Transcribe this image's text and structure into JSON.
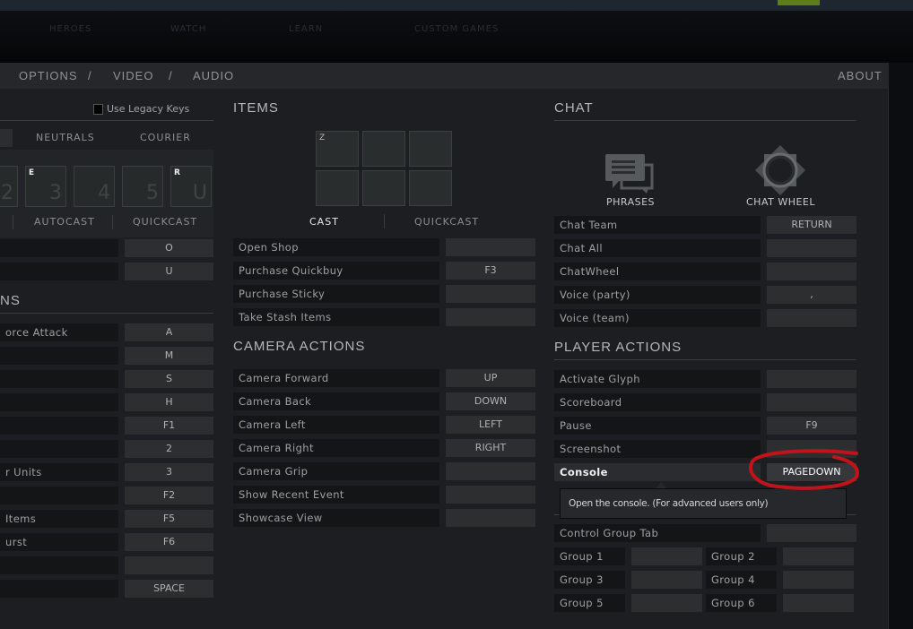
{
  "top_nav": [
    "HEROES",
    "WATCH",
    "LEARN",
    "CUSTOM GAMES"
  ],
  "header": {
    "nav": [
      "OPTIONS",
      "/",
      "VIDEO",
      "/",
      "AUDIO"
    ],
    "about": "ABOUT"
  },
  "left": {
    "legacy_keys": "Use Legacy Keys",
    "tabs": [
      "NEUTRALS",
      "COURIER"
    ],
    "abilities": [
      {
        "hotkey": "",
        "num": "2"
      },
      {
        "hotkey": "E",
        "num": "3"
      },
      {
        "hotkey": "",
        "num": "4"
      },
      {
        "hotkey": "",
        "num": "5"
      },
      {
        "hotkey": "R",
        "num": "U"
      }
    ],
    "cast_tabs": [
      "AUTOCAST",
      "QUICKCAST"
    ],
    "top_rows": [
      {
        "label": "",
        "key": "O"
      },
      {
        "label": "",
        "key": "U"
      }
    ],
    "section": "NS",
    "rows": [
      {
        "label": "orce Attack",
        "key": "A"
      },
      {
        "label": "",
        "key": "M"
      },
      {
        "label": "",
        "key": "S"
      },
      {
        "label": "",
        "key": "H"
      },
      {
        "label": "",
        "key": "F1"
      },
      {
        "label": "",
        "key": "2"
      },
      {
        "label": "r Units",
        "key": "3"
      },
      {
        "label": "",
        "key": "F2"
      },
      {
        "label": "Items",
        "key": "F5"
      },
      {
        "label": "urst",
        "key": "F6"
      },
      {
        "label": "",
        "key": ""
      },
      {
        "label": "",
        "key": "SPACE"
      }
    ]
  },
  "items": {
    "title": "ITEMS",
    "slot_hotkeys": [
      "Z",
      "",
      "",
      "",
      "",
      ""
    ],
    "tabs": [
      "CAST",
      "QUICKCAST"
    ],
    "rows": [
      {
        "label": "Open Shop",
        "key": ""
      },
      {
        "label": "Purchase Quickbuy",
        "key": "F3"
      },
      {
        "label": "Purchase Sticky",
        "key": ""
      },
      {
        "label": "Take Stash Items",
        "key": ""
      }
    ]
  },
  "camera": {
    "title": "CAMERA ACTIONS",
    "rows": [
      {
        "label": "Camera Forward",
        "key": "UP"
      },
      {
        "label": "Camera Back",
        "key": "DOWN"
      },
      {
        "label": "Camera Left",
        "key": "LEFT"
      },
      {
        "label": "Camera Right",
        "key": "RIGHT"
      },
      {
        "label": "Camera Grip",
        "key": ""
      },
      {
        "label": "Show Recent Event",
        "key": ""
      },
      {
        "label": "Showcase View",
        "key": ""
      }
    ]
  },
  "chat": {
    "title": "CHAT",
    "phrases": "PHRASES",
    "chat_wheel": "CHAT WHEEL",
    "rows": [
      {
        "label": "Chat Team",
        "key": "RETURN"
      },
      {
        "label": "Chat All",
        "key": ""
      },
      {
        "label": "ChatWheel",
        "key": ""
      },
      {
        "label": "Voice (party)",
        "key": ","
      },
      {
        "label": "Voice (team)",
        "key": ""
      }
    ]
  },
  "player": {
    "title": "PLAYER ACTIONS",
    "rows": [
      {
        "label": "Activate Glyph",
        "key": ""
      },
      {
        "label": "Scoreboard",
        "key": ""
      },
      {
        "label": "Pause",
        "key": "F9"
      },
      {
        "label": "Screenshot",
        "key": ""
      },
      {
        "label": "Console",
        "key": "PAGEDOWN"
      }
    ]
  },
  "tooltip": "Open the console. (For advanced users only)",
  "control": {
    "tab_row": {
      "label": "Control Group Tab",
      "key": ""
    },
    "groups": [
      {
        "label": "Group 1",
        "key": ""
      },
      {
        "label": "Group 2",
        "key": ""
      },
      {
        "label": "Group 3",
        "key": ""
      },
      {
        "label": "Group 4",
        "key": ""
      },
      {
        "label": "Group 5",
        "key": ""
      },
      {
        "label": "Group 6",
        "key": ""
      }
    ]
  },
  "colors": {
    "annotation": "#c0141a",
    "accent": "#5e7d17"
  }
}
